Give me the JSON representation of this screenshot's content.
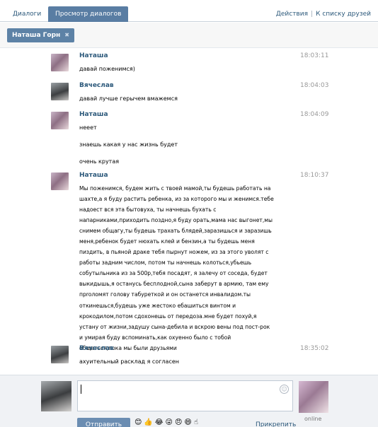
{
  "tabs": {
    "dialogs": "Диалоги",
    "view_dialogs": "Просмотр диалогов",
    "actions": "Действия",
    "separator": "|",
    "to_friends": "К списку друзей"
  },
  "filter": {
    "chip_label": "Наташа Горн",
    "chip_close": "✖"
  },
  "messages": [
    {
      "author": "Наташа",
      "time": "18:03:11",
      "lines": [
        "давай поженимся)"
      ]
    },
    {
      "author": "Вячеслав",
      "time": "18:04:03",
      "lines": [
        "давай лучше герычем вмажемся"
      ]
    },
    {
      "author": "Наташа",
      "time": "18:04:09",
      "lines": [
        "нееет",
        "знаешь какая у нас жизнь будет",
        "очень крутая"
      ]
    },
    {
      "author": "Наташа",
      "time": "18:10:37",
      "lines": [
        "Мы поженимся, будем жить с твоей мамой,ты будешь работать на",
        "шахте,а я буду растить ребенка, из за которого мы и женимся.тебе",
        "надоест вся эта бытовуха, ты начнешь бухать с",
        "напарниками,приходить поздно,я буду орать,мама нас выгонет,мы",
        "снимем общагу,ты будешь трахать блядей,заразишься и заразишь",
        "меня,ребенок будет нюхать клей и бензин,а ты будешь меня",
        "пиздить, в пьяной драке тебя пырнут ножем, из за этого уволят с",
        "работы задним числом, потом ты начнешь колоться,убьешь",
        "собутыльника из за 500р,тебя посадят, я залечу от соседа, будет",
        "выкидышь,я останусь бесплодной,сына заберут в армию, там ему",
        "пproломят голову табуреткой и он останется инвалидом.ты",
        "откинешься,будешь уже жестоко ебашиться винтом и",
        "крокодилом,потом сдохонешь от передоза.мне будет похуй,я",
        "устану от жизни,задушу сына-дебила и вскрою вены под пост-рок",
        "и умирая буду вспоминать,как охуенно было с тобой",
        "общаться,пока мы были друзьями"
      ]
    },
    {
      "author": "Вячеслав",
      "time": "18:35:02",
      "lines": [
        "ахуительный расклад я согласен"
      ]
    }
  ],
  "composer": {
    "input_value": "",
    "smile_glyph": "☺",
    "send_label": "Отправить",
    "emojis": "😊👍😂😜😠😄☝",
    "attach_label": "Прикрепить",
    "online_label": "online"
  }
}
